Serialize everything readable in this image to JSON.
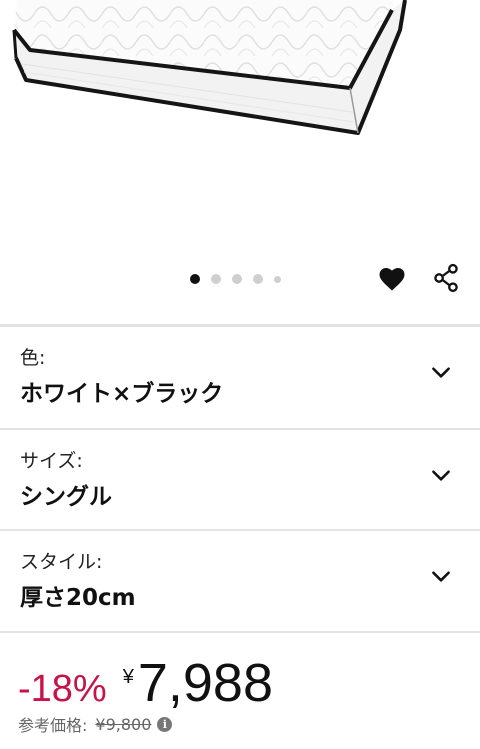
{
  "gallery": {
    "image_alt": "mattress-image",
    "dot_count": 5,
    "active_index": 0
  },
  "actions": {
    "favorite_icon": "heart-icon",
    "share_icon": "share-icon"
  },
  "options": {
    "color": {
      "label": "色:",
      "value": "ホワイト×ブラック"
    },
    "size": {
      "label": "サイズ:",
      "value": "シングル"
    },
    "style": {
      "label": "スタイル:",
      "value": "厚さ20cm"
    }
  },
  "pricing": {
    "discount": "-18%",
    "currency_symbol": "¥",
    "price": "7,988",
    "reference_label": "参考価格:",
    "reference_price": "¥9,800",
    "discount_color": "#c7124a"
  }
}
